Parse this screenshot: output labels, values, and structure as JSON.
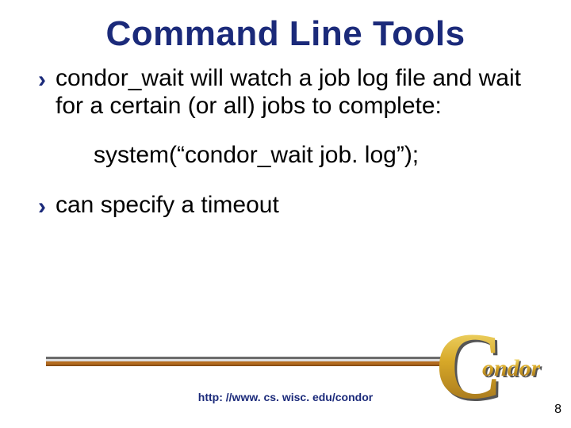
{
  "title": "Command Line Tools",
  "bullets": [
    "condor_wait will watch a job log file and wait for a certain (or all) jobs to complete:",
    "can specify a timeout"
  ],
  "code_line": "system(“condor_wait job. log”);",
  "footer_url": "http: //www. cs. wisc. edu/condor",
  "page_number": "8",
  "logo": {
    "big_c": "C",
    "rest": "ondor"
  },
  "bullet_glyph": "›"
}
